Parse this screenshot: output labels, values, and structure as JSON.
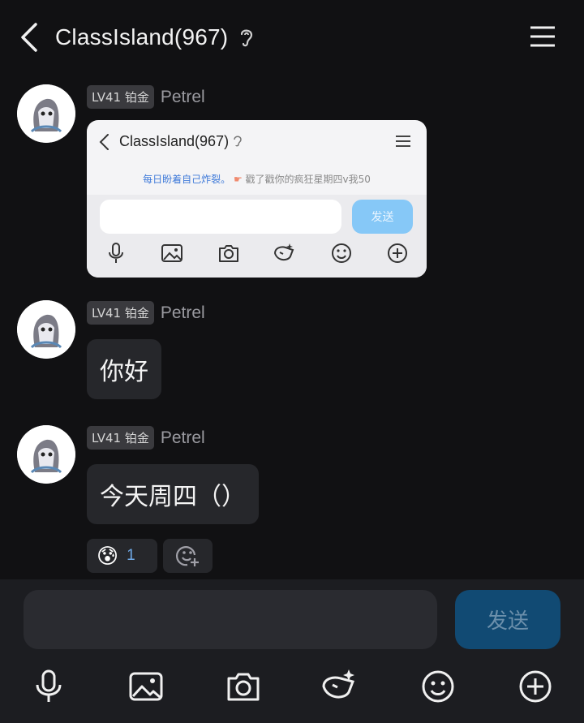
{
  "header": {
    "title": "ClassIsland(967)",
    "icons": [
      "back-icon",
      "ear-icon",
      "menu-icon"
    ]
  },
  "messages": [
    {
      "level": "LV41 铂金",
      "sender": "Petrel",
      "type": "image",
      "image": {
        "title": "ClassIsland(967)",
        "notice_link": "每日盼着自己炸裂。",
        "notice_text": "戳了戳你的疯狂星期四v我50",
        "send_label": "发送",
        "tools": [
          "mic-icon",
          "image-icon",
          "camera-icon",
          "sticker-icon",
          "emoji-icon",
          "plus-icon"
        ]
      }
    },
    {
      "level": "LV41 铂金",
      "sender": "Petrel",
      "type": "text",
      "text": "你好"
    },
    {
      "level": "LV41 铂金",
      "sender": "Petrel",
      "type": "text",
      "text": "今天周四（）",
      "reactions": [
        {
          "emoji": "😰",
          "count": "1"
        }
      ]
    }
  ],
  "composer": {
    "input_value": "",
    "send_label": "发送",
    "tools": [
      "mic-icon",
      "image-icon",
      "camera-icon",
      "sticker-icon",
      "emoji-icon",
      "plus-icon"
    ]
  },
  "colors": {
    "background": "#111113",
    "bubble": "#26272b",
    "send_button": "#114a73",
    "reaction_count": "#6fa8e6"
  }
}
